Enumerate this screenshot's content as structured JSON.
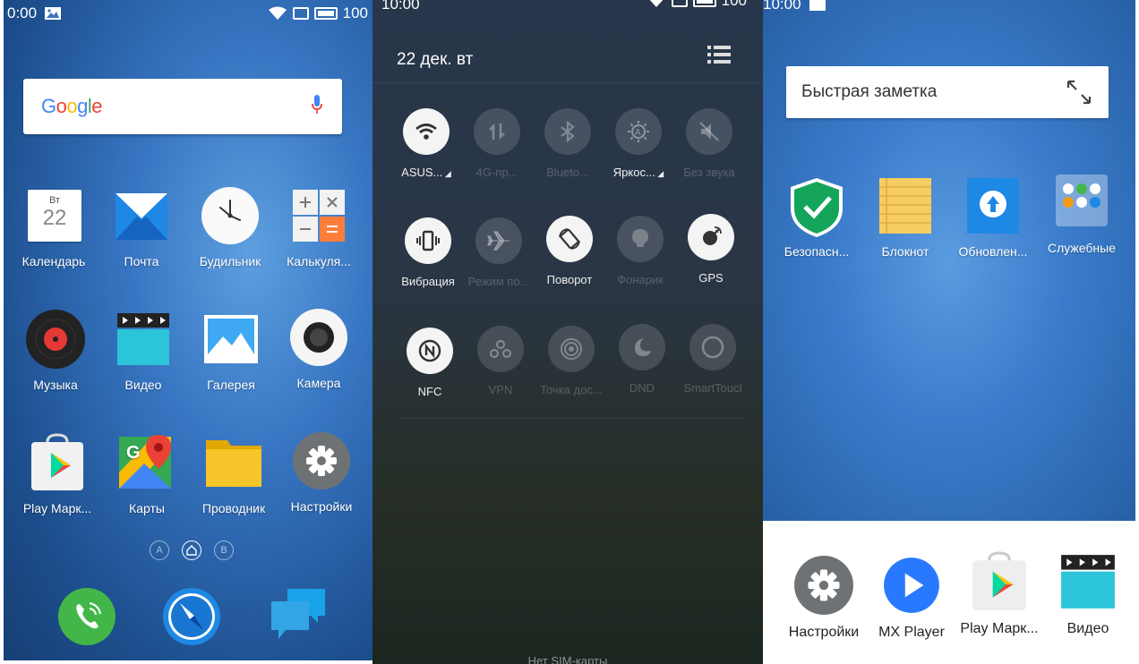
{
  "panel1": {
    "status": {
      "time": "0:00",
      "battery": "100"
    },
    "search": {
      "logo": "Google"
    },
    "apps": [
      {
        "label": "Календарь",
        "icon": "calendar-icon",
        "day_name": "Вт",
        "day_num": "22"
      },
      {
        "label": "Почта",
        "icon": "mail-icon"
      },
      {
        "label": "Будильник",
        "icon": "clock-icon"
      },
      {
        "label": "Калькуля...",
        "icon": "calculator-icon"
      },
      {
        "label": "Музыка",
        "icon": "music-icon"
      },
      {
        "label": "Видео",
        "icon": "video-icon"
      },
      {
        "label": "Галерея",
        "icon": "gallery-icon"
      },
      {
        "label": "Камера",
        "icon": "camera-icon"
      },
      {
        "label": "Play Марк...",
        "icon": "play-store-icon"
      },
      {
        "label": "Карты",
        "icon": "maps-icon"
      },
      {
        "label": "Проводник",
        "icon": "folder-icon"
      },
      {
        "label": "Настройки",
        "icon": "settings-icon"
      }
    ],
    "pager": [
      "A",
      "",
      "B"
    ],
    "dock": [
      "phone-icon",
      "compass-icon",
      "messages-icon"
    ]
  },
  "panel2": {
    "status": {
      "time": "10:00",
      "battery": "100"
    },
    "date": "22 дек. вт",
    "tiles": [
      {
        "label": "ASUS...",
        "state": "on",
        "icon": "wifi-icon"
      },
      {
        "label": "4G-пр...",
        "state": "off",
        "icon": "mobile-data-icon"
      },
      {
        "label": "Blueto...",
        "state": "off",
        "icon": "bluetooth-icon"
      },
      {
        "label": "Яркос...",
        "state": "dim",
        "icon": "brightness-icon"
      },
      {
        "label": "Без звука",
        "state": "off",
        "icon": "mute-icon"
      },
      {
        "label": "Вибрация",
        "state": "on",
        "icon": "vibration-icon"
      },
      {
        "label": "Режим по...",
        "state": "off",
        "icon": "airplane-icon"
      },
      {
        "label": "Поворот",
        "state": "on",
        "icon": "rotate-icon"
      },
      {
        "label": "Фонарик",
        "state": "off",
        "icon": "flashlight-icon"
      },
      {
        "label": "GPS",
        "state": "on",
        "icon": "gps-icon"
      },
      {
        "label": "NFC",
        "state": "on",
        "icon": "nfc-icon"
      },
      {
        "label": "VPN",
        "state": "off",
        "icon": "vpn-icon"
      },
      {
        "label": "Точка дос...",
        "state": "off",
        "icon": "hotspot-icon"
      },
      {
        "label": "DND",
        "state": "off",
        "icon": "dnd-icon"
      },
      {
        "label": "SmartToucl",
        "state": "off",
        "icon": "smarttouch-icon"
      }
    ],
    "footer": "Нет SIM-карты"
  },
  "panel3": {
    "status": {
      "time": "10:00"
    },
    "note_placeholder": "Быстрая заметка",
    "apps": [
      {
        "label": "Безопасн...",
        "icon": "security-icon"
      },
      {
        "label": "Блокнот",
        "icon": "notepad-icon"
      },
      {
        "label": "Обновлен...",
        "icon": "update-icon"
      },
      {
        "label": "Служебные",
        "icon": "tools-folder-icon"
      }
    ],
    "dock": [
      {
        "label": "Настройки",
        "icon": "settings-icon"
      },
      {
        "label": "MX Player",
        "icon": "mx-player-icon"
      },
      {
        "label": "Play Марк...",
        "icon": "play-store-icon"
      },
      {
        "label": "Видео",
        "icon": "video-icon"
      }
    ]
  }
}
